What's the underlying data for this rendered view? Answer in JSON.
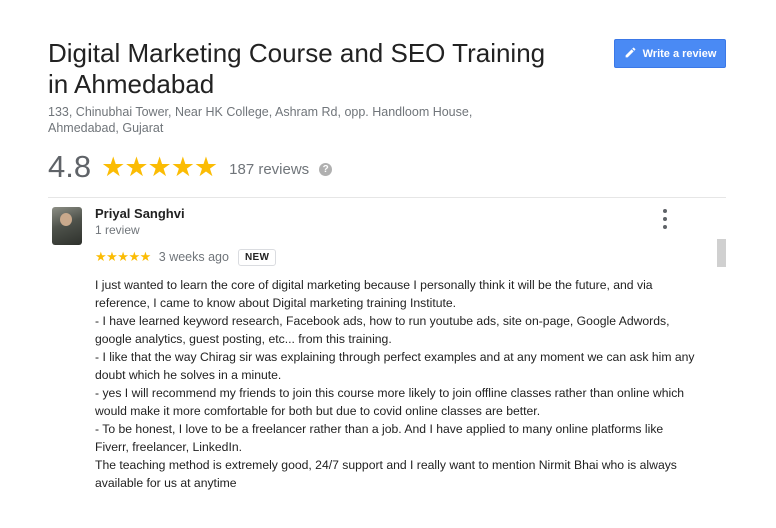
{
  "place": {
    "title": "Digital Marketing Course and SEO Training in Ahmedabad",
    "address": "133, Chinubhai Tower, Near HK College, Ashram Rd, opp. Handloom House, Ahmedabad, Gujarat"
  },
  "write_review": {
    "label": "Write a review",
    "icon": "pencil-icon"
  },
  "rating": {
    "value": "4.8",
    "stars": "★★★★★",
    "count_text": "187 reviews",
    "help_icon": "?"
  },
  "review": {
    "author": "Priyal Sanghvi",
    "author_meta": "1 review",
    "stars": "★★★★★",
    "time": "3 weeks ago",
    "badge": "NEW",
    "lines": [
      "I just wanted to learn the core of digital marketing because I personally think it will be the future, and via reference, I came to know about Digital marketing training Institute.",
      "- I have learned keyword research, Facebook ads, how to run youtube ads, site on-page, Google Adwords, google analytics, guest posting,  etc... from this training.",
      "- I like that the way Chirag sir was explaining through perfect examples and at any moment we can ask him any doubt which he solves in a minute.",
      "- yes I will recommend my friends to join this course more likely to join offline classes rather than online which would make it more comfortable for both but due to covid online classes are better.",
      "- To be honest, I love to be a freelancer rather than a job. And I have applied to many online platforms like Fiverr, freelancer, LinkedIn.",
      "The teaching method is extremely good, 24/7 support and I really want to mention Nirmit Bhai who is always available for us at anytime"
    ]
  },
  "colors": {
    "star": "#fbbc04",
    "button": "#4a8af4",
    "muted": "#70757a"
  }
}
